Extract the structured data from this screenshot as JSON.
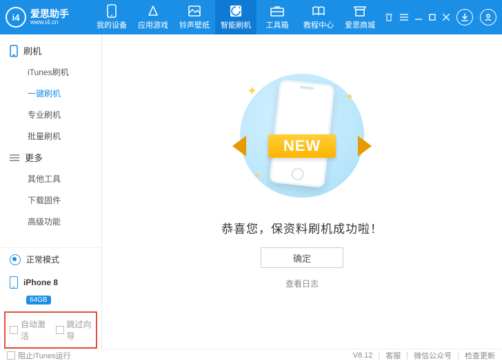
{
  "brand": {
    "name": "爱思助手",
    "url": "www.i4.cn",
    "logo_text": "i4"
  },
  "nav": [
    {
      "label": "我的设备"
    },
    {
      "label": "应用游戏"
    },
    {
      "label": "铃声壁纸"
    },
    {
      "label": "智能刷机",
      "active": true
    },
    {
      "label": "工具箱"
    },
    {
      "label": "教程中心"
    },
    {
      "label": "爱思商城"
    }
  ],
  "sidebar": {
    "group1": {
      "title": "刷机",
      "items": [
        "iTunes刷机",
        "一键刷机",
        "专业刷机",
        "批量刷机"
      ],
      "active_index": 1
    },
    "group2": {
      "title": "更多",
      "items": [
        "其他工具",
        "下载固件",
        "高级功能"
      ]
    },
    "mode": "正常模式",
    "device": {
      "name": "iPhone 8",
      "storage": "64GB"
    },
    "checks": {
      "auto_activate": "自动激活",
      "skip_guide": "跳过向导"
    }
  },
  "main": {
    "ribbon": "NEW",
    "headline": "恭喜您，保资料刷机成功啦！",
    "ok": "确定",
    "log": "查看日志"
  },
  "status": {
    "left": "阻止iTunes运行",
    "version": "V8.12",
    "support": "客服",
    "wechat": "微信公众号",
    "update": "检查更新"
  }
}
